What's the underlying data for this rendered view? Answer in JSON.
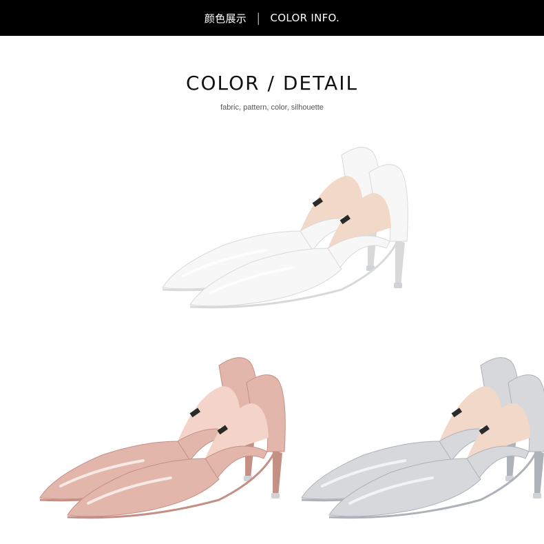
{
  "header": {
    "zh_label": "颜色展示",
    "separator": "|",
    "en_label": "COLOR INFO."
  },
  "section": {
    "title": "COLOR / DETAIL",
    "subtitle": "fabric, pattern, color, silhouette"
  },
  "products": [
    {
      "color_name": "white",
      "color_hex": "#f7f7f7",
      "shade_hex": "#d9d9d9",
      "lining_hex": "#f1d8c8"
    },
    {
      "color_name": "pink",
      "color_hex": "#e3b6ac",
      "shade_hex": "#c48f85",
      "lining_hex": "#f4d4c8"
    },
    {
      "color_name": "grey",
      "color_hex": "#d6d8dc",
      "shade_hex": "#adb1b8",
      "lining_hex": "#f1d8c8"
    }
  ]
}
